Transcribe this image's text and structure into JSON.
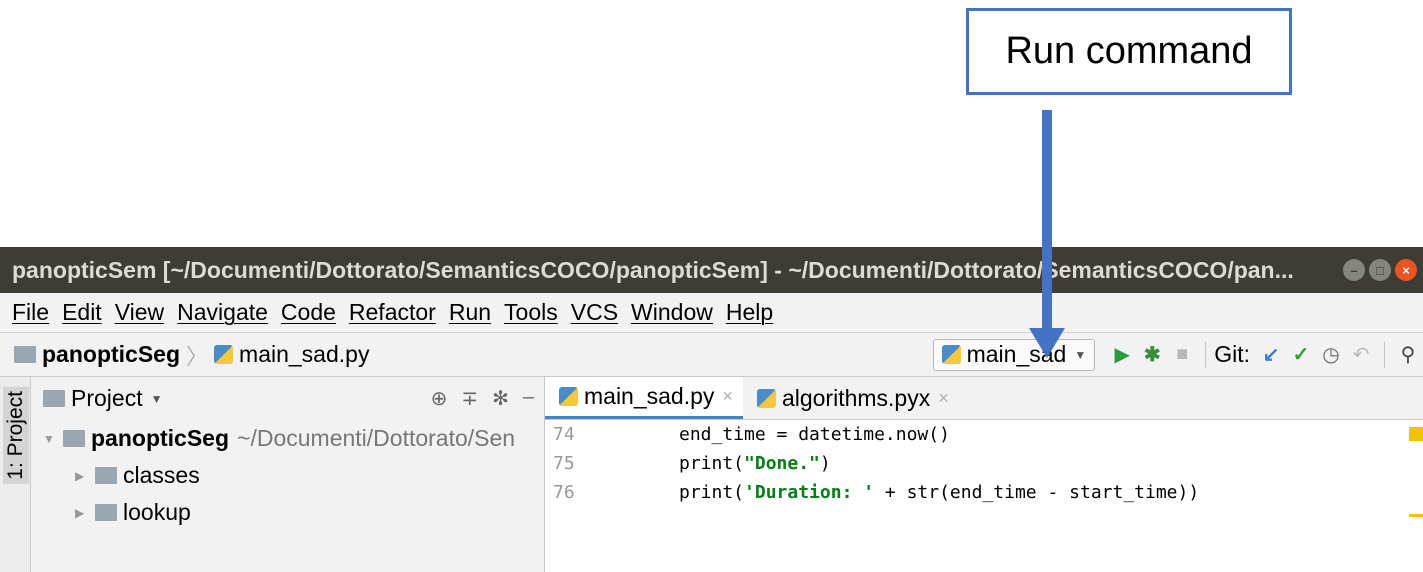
{
  "annotation": {
    "callout_text": "Run command"
  },
  "window": {
    "title": "panopticSem [~/Documenti/Dottorato/SemanticsCOCO/panopticSem] - ~/Documenti/Dottorato/SemanticsCOCO/pan...",
    "buttons": {
      "minimize": "–",
      "maximize": "□",
      "close": "×"
    }
  },
  "menu": {
    "items": [
      "File",
      "Edit",
      "View",
      "Navigate",
      "Code",
      "Refactor",
      "Run",
      "Tools",
      "VCS",
      "Window",
      "Help"
    ]
  },
  "navbar": {
    "project": "panopticSeg",
    "file": "main_sad.py",
    "run_config": "main_sad",
    "git_label": "Git:",
    "icons": [
      "run-icon",
      "debug-icon",
      "stop-icon",
      "git-update-icon",
      "git-commit-icon",
      "history-icon",
      "revert-icon",
      "search-icon"
    ]
  },
  "sidebar": {
    "strip_label": "1: Project"
  },
  "project_panel": {
    "header": "Project",
    "tree": [
      {
        "name": "panopticSeg",
        "path": "~/Documenti/Dottorato/Sen"
      },
      {
        "name": "classes"
      },
      {
        "name": "lookup"
      }
    ]
  },
  "editor": {
    "tabs": [
      "main_sad.py",
      "algorithms.pyx"
    ],
    "lines": [
      {
        "num": "74",
        "code": "end_time = datetime.now()"
      },
      {
        "num": "75",
        "code_pre": "print(",
        "code_str": "\"Done.\"",
        "code_post": ")"
      },
      {
        "num": "76",
        "code_pre": "print(",
        "code_str": "'Duration: '",
        "code_post": " + str(end_time - start_time))"
      }
    ]
  },
  "colors": {
    "accent": "#4472c4",
    "titlebar": "#3d3c37",
    "run_green": "#2b9a3e",
    "close": "#e95420"
  }
}
